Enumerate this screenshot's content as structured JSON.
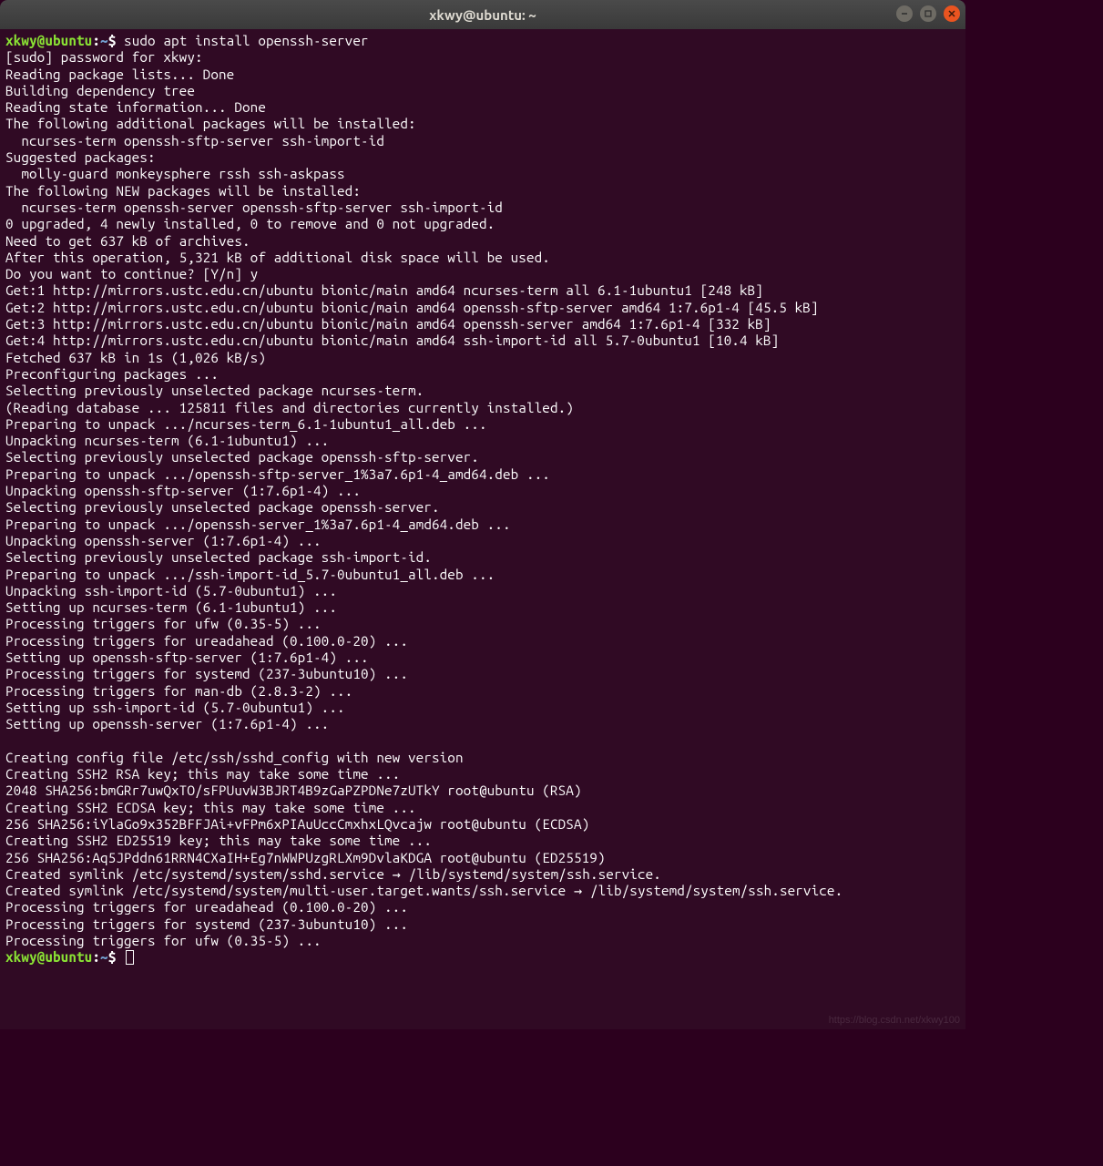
{
  "titlebar": {
    "title": "xkwy@ubuntu: ~"
  },
  "prompt": {
    "user_host": "xkwy@ubuntu",
    "sep": ":",
    "path": "~",
    "dollar": "$"
  },
  "command1": " sudo apt install openssh-server",
  "output_lines": [
    "[sudo] password for xkwy:",
    "Reading package lists... Done",
    "Building dependency tree",
    "Reading state information... Done",
    "The following additional packages will be installed:",
    "  ncurses-term openssh-sftp-server ssh-import-id",
    "Suggested packages:",
    "  molly-guard monkeysphere rssh ssh-askpass",
    "The following NEW packages will be installed:",
    "  ncurses-term openssh-server openssh-sftp-server ssh-import-id",
    "0 upgraded, 4 newly installed, 0 to remove and 0 not upgraded.",
    "Need to get 637 kB of archives.",
    "After this operation, 5,321 kB of additional disk space will be used.",
    "Do you want to continue? [Y/n] y",
    "Get:1 http://mirrors.ustc.edu.cn/ubuntu bionic/main amd64 ncurses-term all 6.1-1ubuntu1 [248 kB]",
    "Get:2 http://mirrors.ustc.edu.cn/ubuntu bionic/main amd64 openssh-sftp-server amd64 1:7.6p1-4 [45.5 kB]",
    "Get:3 http://mirrors.ustc.edu.cn/ubuntu bionic/main amd64 openssh-server amd64 1:7.6p1-4 [332 kB]",
    "Get:4 http://mirrors.ustc.edu.cn/ubuntu bionic/main amd64 ssh-import-id all 5.7-0ubuntu1 [10.4 kB]",
    "Fetched 637 kB in 1s (1,026 kB/s)",
    "Preconfiguring packages ...",
    "Selecting previously unselected package ncurses-term.",
    "(Reading database ... 125811 files and directories currently installed.)",
    "Preparing to unpack .../ncurses-term_6.1-1ubuntu1_all.deb ...",
    "Unpacking ncurses-term (6.1-1ubuntu1) ...",
    "Selecting previously unselected package openssh-sftp-server.",
    "Preparing to unpack .../openssh-sftp-server_1%3a7.6p1-4_amd64.deb ...",
    "Unpacking openssh-sftp-server (1:7.6p1-4) ...",
    "Selecting previously unselected package openssh-server.",
    "Preparing to unpack .../openssh-server_1%3a7.6p1-4_amd64.deb ...",
    "Unpacking openssh-server (1:7.6p1-4) ...",
    "Selecting previously unselected package ssh-import-id.",
    "Preparing to unpack .../ssh-import-id_5.7-0ubuntu1_all.deb ...",
    "Unpacking ssh-import-id (5.7-0ubuntu1) ...",
    "Setting up ncurses-term (6.1-1ubuntu1) ...",
    "Processing triggers for ufw (0.35-5) ...",
    "Processing triggers for ureadahead (0.100.0-20) ...",
    "Setting up openssh-sftp-server (1:7.6p1-4) ...",
    "Processing triggers for systemd (237-3ubuntu10) ...",
    "Processing triggers for man-db (2.8.3-2) ...",
    "Setting up ssh-import-id (5.7-0ubuntu1) ...",
    "Setting up openssh-server (1:7.6p1-4) ...",
    "",
    "Creating config file /etc/ssh/sshd_config with new version",
    "Creating SSH2 RSA key; this may take some time ...",
    "2048 SHA256:bmGRr7uwQxTO/sFPUuvW3BJRT4B9zGaPZPDNe7zUTkY root@ubuntu (RSA)",
    "Creating SSH2 ECDSA key; this may take some time ...",
    "256 SHA256:iYlaGo9x352BFFJAi+vFPm6xPIAuUccCmxhxLQvcajw root@ubuntu (ECDSA)",
    "Creating SSH2 ED25519 key; this may take some time ...",
    "256 SHA256:Aq5JPddn61RRN4CXaIH+Eg7nWWPUzgRLXm9DvlaKDGA root@ubuntu (ED25519)",
    "Created symlink /etc/systemd/system/sshd.service → /lib/systemd/system/ssh.service.",
    "Created symlink /etc/systemd/system/multi-user.target.wants/ssh.service → /lib/systemd/system/ssh.service.",
    "Processing triggers for ureadahead (0.100.0-20) ...",
    "Processing triggers for systemd (237-3ubuntu10) ...",
    "Processing triggers for ufw (0.35-5) ..."
  ],
  "watermark": "https://blog.csdn.net/xkwy100"
}
